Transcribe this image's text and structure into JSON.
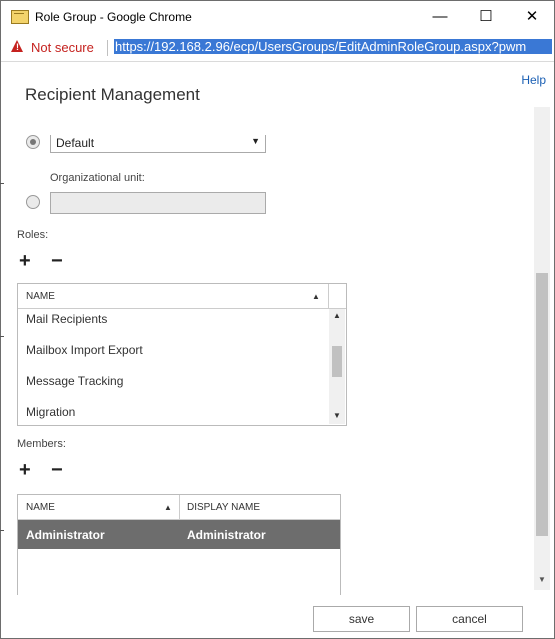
{
  "window": {
    "title": "Role Group - Google Chrome",
    "minimize_glyph": "—",
    "maximize_glyph": "☐",
    "close_glyph": "✕"
  },
  "address_bar": {
    "security_text": "Not secure",
    "url": "https://192.168.2.96/ecp/UsersGroups/EditAdminRoleGroup.aspx?pwm"
  },
  "page": {
    "help_link": "Help",
    "title": "Recipient Management"
  },
  "scope": {
    "default_select_value": "Default",
    "ou_label": "Organizational unit:",
    "ou_value": ""
  },
  "roles": {
    "label": "Roles:",
    "add": "+",
    "remove": "−",
    "column_name": "NAME",
    "items": [
      "Mail Recipients",
      "Mailbox Import Export",
      "Message Tracking",
      "Migration"
    ]
  },
  "members": {
    "label": "Members:",
    "add": "+",
    "remove": "−",
    "columns": [
      "NAME",
      "DISPLAY NAME"
    ],
    "rows": [
      {
        "name": "Administrator",
        "display_name": "Administrator"
      }
    ]
  },
  "footer": {
    "save": "save",
    "cancel": "cancel"
  }
}
